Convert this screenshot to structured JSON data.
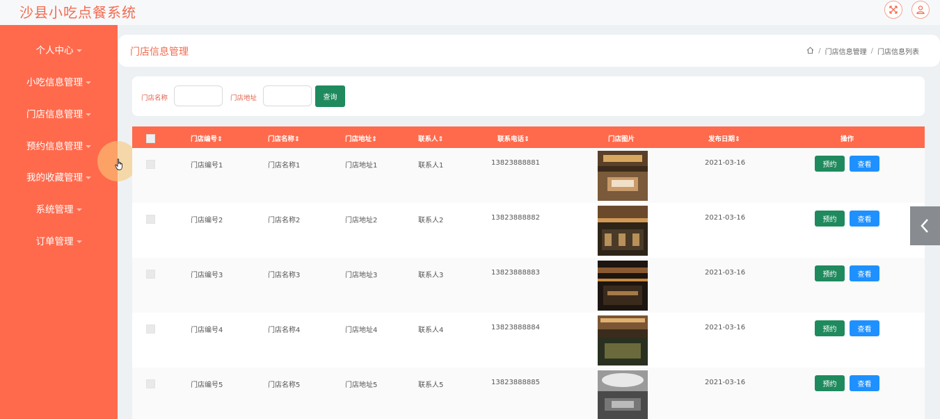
{
  "app_title": "沙县小吃点餐系统",
  "top_icons": [
    "fullscreen-icon",
    "user-icon"
  ],
  "sidebar": {
    "items": [
      {
        "label": "个人中心"
      },
      {
        "label": "小吃信息管理"
      },
      {
        "label": "门店信息管理"
      },
      {
        "label": "预约信息管理"
      },
      {
        "label": "我的收藏管理"
      },
      {
        "label": "系统管理"
      },
      {
        "label": "订单管理"
      }
    ]
  },
  "header": {
    "title": "门店信息管理",
    "breadcrumb": [
      "门店信息管理",
      "门店信息列表"
    ]
  },
  "search": {
    "name_label": "门店名称",
    "name_value": "",
    "address_label": "门店地址",
    "address_value": "",
    "query_label": "查询"
  },
  "table": {
    "columns": [
      "门店编号",
      "门店名称",
      "门店地址",
      "联系人",
      "联系电话",
      "门店图片",
      "发布日期",
      "操作"
    ],
    "sortable": [
      "门店编号",
      "门店名称",
      "门店地址",
      "联系人",
      "联系电话",
      "发布日期"
    ],
    "rows": [
      {
        "id": "门店编号1",
        "name": "门店名称1",
        "address": "门店地址1",
        "contact": "联系人1",
        "phone": "13823888881",
        "date": "2021-03-16"
      },
      {
        "id": "门店编号2",
        "name": "门店名称2",
        "address": "门店地址2",
        "contact": "联系人2",
        "phone": "13823888882",
        "date": "2021-03-16"
      },
      {
        "id": "门店编号3",
        "name": "门店名称3",
        "address": "门店地址3",
        "contact": "联系人3",
        "phone": "13823888883",
        "date": "2021-03-16"
      },
      {
        "id": "门店编号4",
        "name": "门店名称4",
        "address": "门店地址4",
        "contact": "联系人4",
        "phone": "13823888884",
        "date": "2021-03-16"
      },
      {
        "id": "门店编号5",
        "name": "门店名称5",
        "address": "门店地址5",
        "contact": "联系人5",
        "phone": "13823888885",
        "date": "2021-03-16"
      }
    ],
    "actions": {
      "reserve_label": "预约",
      "view_label": "查看"
    }
  },
  "colors": {
    "accent": "#ff6a4c",
    "title": "#f26b4f",
    "green": "#1f8a5d",
    "blue": "#1e90ff"
  }
}
